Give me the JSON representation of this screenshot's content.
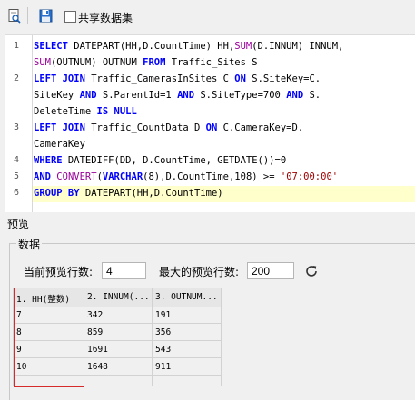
{
  "toolbar": {
    "share_dataset_label": "共享数据集",
    "share_dataset_checked": false
  },
  "editor": {
    "line_numbers": [
      "1",
      "2",
      "3",
      "4",
      "5",
      "6"
    ],
    "lines": [
      [
        {
          "t": "SELECT",
          "c": "kw"
        },
        {
          "t": " DATEPART(HH,D.CountTime) HH,",
          "c": ""
        },
        {
          "t": "SUM",
          "c": "fn"
        },
        {
          "t": "(D.INNUM) INNUM,",
          "c": ""
        }
      ],
      [
        {
          "t": "SUM",
          "c": "fn"
        },
        {
          "t": "(OUTNUM) OUTNUM ",
          "c": ""
        },
        {
          "t": "FROM",
          "c": "kw"
        },
        {
          "t": " Traffic_Sites S",
          "c": ""
        }
      ],
      [
        {
          "t": "LEFT JOIN",
          "c": "kw"
        },
        {
          "t": " Traffic_CamerasInSites C ",
          "c": ""
        },
        {
          "t": "ON",
          "c": "kw"
        },
        {
          "t": " S.SiteKey=C.",
          "c": ""
        }
      ],
      [
        {
          "t": "SiteKey ",
          "c": ""
        },
        {
          "t": "AND",
          "c": "kw"
        },
        {
          "t": " S.ParentId=1 ",
          "c": ""
        },
        {
          "t": "AND",
          "c": "kw"
        },
        {
          "t": " S.SiteType=700 ",
          "c": ""
        },
        {
          "t": "AND",
          "c": "kw"
        },
        {
          "t": " S.",
          "c": ""
        }
      ],
      [
        {
          "t": "DeleteTime ",
          "c": ""
        },
        {
          "t": "IS NULL",
          "c": "kw"
        }
      ],
      [
        {
          "t": "LEFT JOIN",
          "c": "kw"
        },
        {
          "t": " Traffic_CountData D ",
          "c": ""
        },
        {
          "t": "ON",
          "c": "kw"
        },
        {
          "t": " C.CameraKey=D.",
          "c": ""
        }
      ],
      [
        {
          "t": "CameraKey",
          "c": ""
        }
      ],
      [
        {
          "t": "WHERE",
          "c": "kw"
        },
        {
          "t": " DATEDIFF(DD, D.CountTime, GETDATE())=0",
          "c": ""
        }
      ],
      [
        {
          "t": "AND",
          "c": "kw"
        },
        {
          "t": " ",
          "c": ""
        },
        {
          "t": "CONVERT",
          "c": "fn"
        },
        {
          "t": "(",
          "c": ""
        },
        {
          "t": "VARCHAR",
          "c": "kw"
        },
        {
          "t": "(8),D.CountTime,108) >= ",
          "c": ""
        },
        {
          "t": "'07:00:00'",
          "c": "st"
        }
      ],
      [
        {
          "t": "GROUP BY",
          "c": "kw"
        },
        {
          "t": " DATEPART(HH,D.CountTime)",
          "c": ""
        }
      ]
    ]
  },
  "preview": {
    "title": "预览",
    "group_title": "数据",
    "current_rows_label": "当前预览行数:",
    "current_rows_value": "4",
    "max_rows_label": "最大的预览行数:",
    "max_rows_value": "200",
    "refresh_icon": "refresh-icon",
    "columns": [
      "1. HH(整数)",
      "2. INNUM(...",
      "3. OUTNUM..."
    ],
    "rows": [
      [
        "7",
        "342",
        "191"
      ],
      [
        "8",
        "859",
        "356"
      ],
      [
        "9",
        "1691",
        "543"
      ],
      [
        "10",
        "1648",
        "911"
      ]
    ],
    "highlight_color": "#d42a2a"
  }
}
